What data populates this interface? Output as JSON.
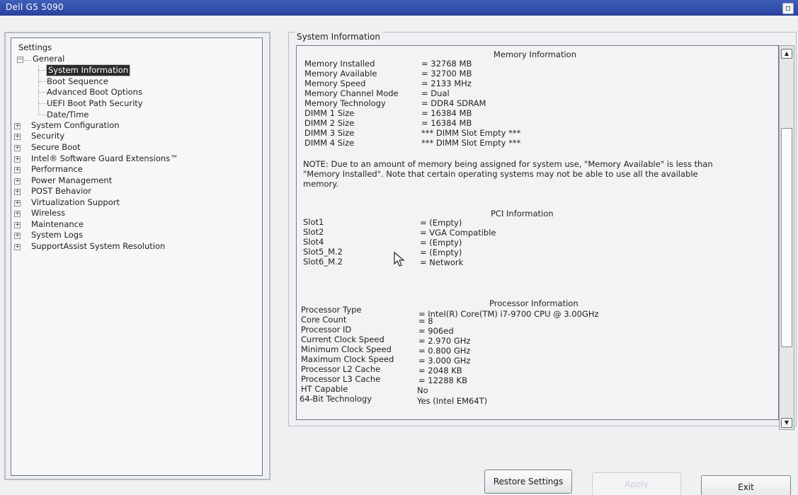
{
  "window": {
    "title": "Dell G5 5090"
  },
  "tree": {
    "root": "Settings",
    "general": {
      "label": "General",
      "children": [
        "System Information",
        "Boot Sequence",
        "Advanced Boot Options",
        "UEFI Boot Path Security",
        "Date/Time"
      ],
      "selected": "System Information"
    },
    "groups": [
      "System Configuration",
      "Security",
      "Secure Boot",
      "Intel® Software Guard Extensions™",
      "Performance",
      "Power Management",
      "POST Behavior",
      "Virtualization Support",
      "Wireless",
      "Maintenance",
      "System Logs",
      "SupportAssist System Resolution"
    ]
  },
  "panel": {
    "label": "System Information",
    "memory": {
      "title": "Memory Information",
      "rows": [
        {
          "k": "Memory Installed",
          "v": "= 32768 MB"
        },
        {
          "k": "Memory Available",
          "v": "= 32700 MB"
        },
        {
          "k": "Memory Speed",
          "v": "= 2133 MHz"
        },
        {
          "k": "Memory Channel Mode",
          "v": "= Dual"
        },
        {
          "k": "Memory Technology",
          "v": "= DDR4 SDRAM"
        },
        {
          "k": "DIMM 1 Size",
          "v": "= 16384 MB"
        },
        {
          "k": "DIMM 2 Size",
          "v": "= 16384 MB"
        },
        {
          "k": "DIMM 3 Size",
          "v": "*** DIMM Slot Empty ***"
        },
        {
          "k": "DIMM 4 Size",
          "v": "*** DIMM Slot Empty ***"
        }
      ],
      "note": "NOTE: Due to an amount of memory being assigned for system use, \"Memory Available\" is less than \"Memory Installed\". Note that certain operating systems may not be able to use all the available memory."
    },
    "pci": {
      "title": "PCI Information",
      "rows": [
        {
          "k": "Slot1",
          "v": "= (Empty)"
        },
        {
          "k": "Slot2",
          "v": "= VGA Compatible"
        },
        {
          "k": "Slot4",
          "v": "= (Empty)"
        },
        {
          "k": "Slot5_M.2",
          "v": "= (Empty)"
        },
        {
          "k": "Slot6_M.2",
          "v": "= Network"
        }
      ]
    },
    "processor": {
      "title": "Processor Information",
      "rows": [
        {
          "k": "Processor Type",
          "v": "= Intel(R) Core(TM) i7-9700 CPU @ 3.00GHz"
        },
        {
          "k": "Core Count",
          "v": "= 8"
        },
        {
          "k": "Processor ID",
          "v": "= 906ed"
        },
        {
          "k": "Current Clock Speed",
          "v": "= 2.970 GHz"
        },
        {
          "k": "Minimum Clock Speed",
          "v": "= 0.800 GHz"
        },
        {
          "k": "Maximum Clock Speed",
          "v": "= 3.000 GHz"
        },
        {
          "k": "Processor L2 Cache",
          "v": "= 2048 KB"
        },
        {
          "k": "Processor L3 Cache",
          "v": "= 12288 KB"
        },
        {
          "k": "HT Capable",
          "v": "No"
        },
        {
          "k": "64-Bit Technology",
          "v": "Yes (Intel EM64T)"
        }
      ]
    }
  },
  "buttons": {
    "restore": "Restore Settings",
    "apply": "Apply",
    "exit": "Exit"
  }
}
